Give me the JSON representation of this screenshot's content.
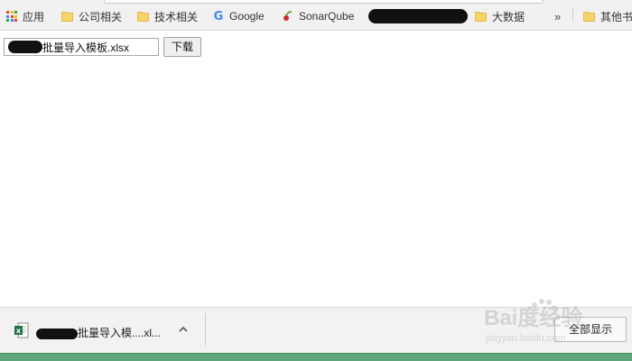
{
  "bookmarks": {
    "apps_label": "应用",
    "items": [
      {
        "label": "公司相关"
      },
      {
        "label": "技术相关"
      },
      {
        "label": "Google"
      },
      {
        "label": "SonarQube"
      },
      {
        "label": "大数据"
      }
    ],
    "overflow_label": "»",
    "other_label": "其他书"
  },
  "main": {
    "file_name": "批量导入模板.xlsx",
    "download_label": "下载"
  },
  "download_shelf": {
    "file_name": "批量导入模....xl...",
    "show_all_label": "全部显示"
  },
  "watermark": {
    "text": "Bai度经验",
    "url": "jingyan.baidu.com"
  },
  "colors": {
    "apps_grid": [
      "#ea4335",
      "#fbbc05",
      "#34a853",
      "#4285f4",
      "#ea4335",
      "#fbbc05",
      "#34a853",
      "#4285f4",
      "#ea4335"
    ],
    "folder": "#f6d46b",
    "excel": "#1f7244",
    "bottom_bar": "#5fa57c"
  }
}
